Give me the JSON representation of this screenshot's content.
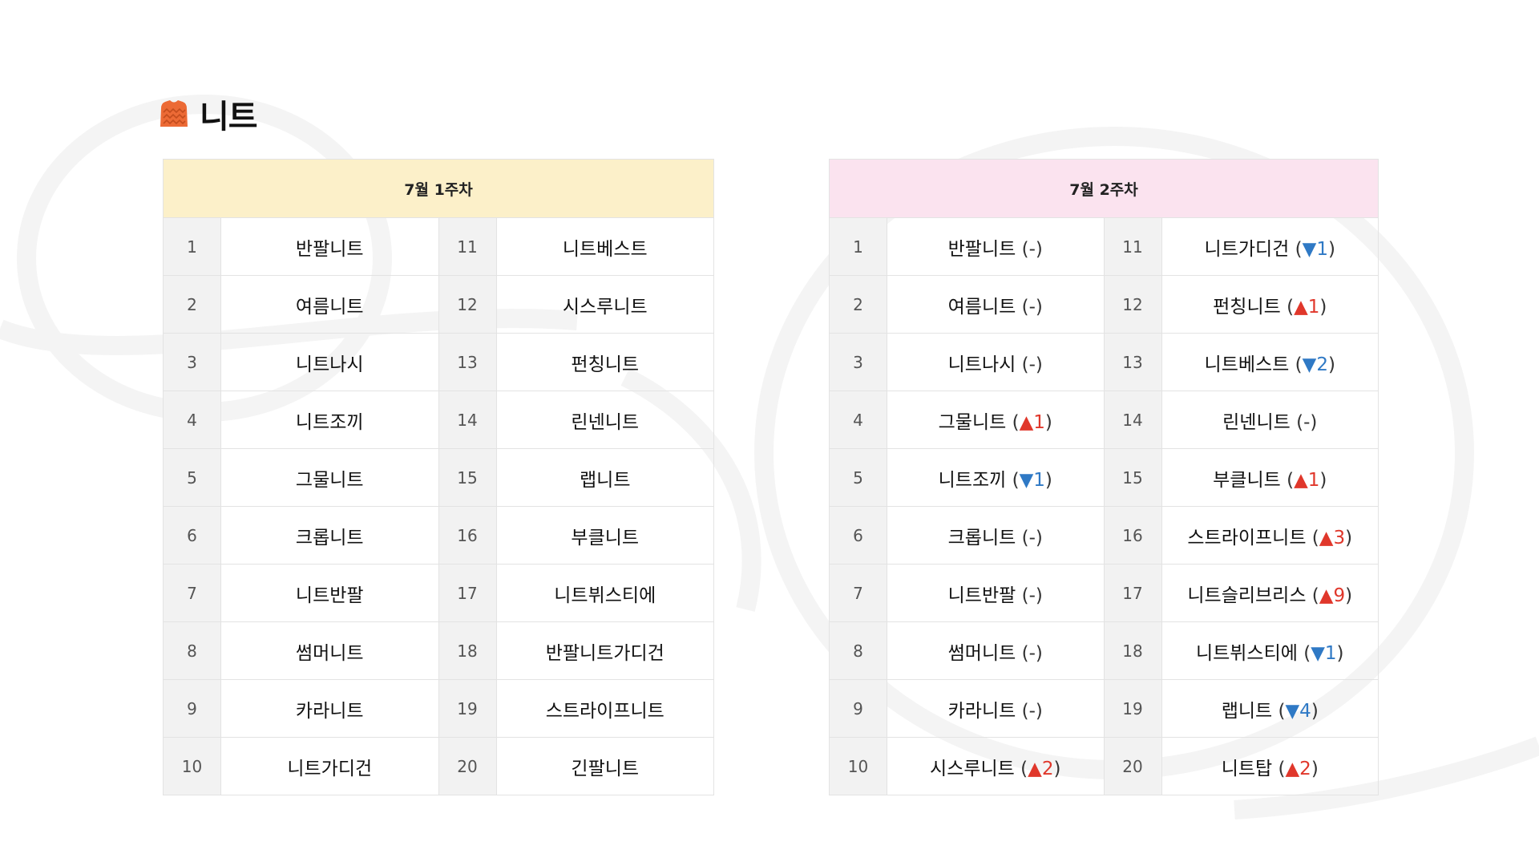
{
  "page": {
    "title": "니트",
    "icon": "knit-sweater-icon"
  },
  "colors": {
    "week1_header_bg": "#fcf0c9",
    "week2_header_bg": "#fbe3ef",
    "rank_up": "#e0372b",
    "rank_down": "#2f79c5",
    "rank_cell_bg": "#f2f2f2"
  },
  "week1": {
    "header": "7월 1주차",
    "rows": [
      {
        "rank_a": "1",
        "item_a": "반팔니트",
        "rank_b": "11",
        "item_b": "니트베스트"
      },
      {
        "rank_a": "2",
        "item_a": "여름니트",
        "rank_b": "12",
        "item_b": "시스루니트"
      },
      {
        "rank_a": "3",
        "item_a": "니트나시",
        "rank_b": "13",
        "item_b": "펀칭니트"
      },
      {
        "rank_a": "4",
        "item_a": "니트조끼",
        "rank_b": "14",
        "item_b": "린넨니트"
      },
      {
        "rank_a": "5",
        "item_a": "그물니트",
        "rank_b": "15",
        "item_b": "랩니트"
      },
      {
        "rank_a": "6",
        "item_a": "크롭니트",
        "rank_b": "16",
        "item_b": "부클니트"
      },
      {
        "rank_a": "7",
        "item_a": "니트반팔",
        "rank_b": "17",
        "item_b": "니트뷔스티에"
      },
      {
        "rank_a": "8",
        "item_a": "썸머니트",
        "rank_b": "18",
        "item_b": "반팔니트가디건"
      },
      {
        "rank_a": "9",
        "item_a": "카라니트",
        "rank_b": "19",
        "item_b": "스트라이프니트"
      },
      {
        "rank_a": "10",
        "item_a": "니트가디건",
        "rank_b": "20",
        "item_b": "긴팔니트"
      }
    ]
  },
  "week2": {
    "header": "7월 2주차",
    "rows": [
      {
        "rank_a": "1",
        "item_a": "반팔니트",
        "change_a": "-",
        "rank_b": "11",
        "item_b": "니트가디건",
        "change_b": "▼1"
      },
      {
        "rank_a": "2",
        "item_a": "여름니트",
        "change_a": "-",
        "rank_b": "12",
        "item_b": "펀칭니트",
        "change_b": "▲1"
      },
      {
        "rank_a": "3",
        "item_a": "니트나시",
        "change_a": "-",
        "rank_b": "13",
        "item_b": "니트베스트",
        "change_b": "▼2"
      },
      {
        "rank_a": "4",
        "item_a": "그물니트",
        "change_a": "▲1",
        "rank_b": "14",
        "item_b": "린넨니트",
        "change_b": "-"
      },
      {
        "rank_a": "5",
        "item_a": "니트조끼",
        "change_a": "▼1",
        "rank_b": "15",
        "item_b": "부클니트",
        "change_b": "▲1"
      },
      {
        "rank_a": "6",
        "item_a": "크롭니트",
        "change_a": "-",
        "rank_b": "16",
        "item_b": "스트라이프니트",
        "change_b": "▲3"
      },
      {
        "rank_a": "7",
        "item_a": "니트반팔",
        "change_a": "-",
        "rank_b": "17",
        "item_b": "니트슬리브리스",
        "change_b": "▲9"
      },
      {
        "rank_a": "8",
        "item_a": "썸머니트",
        "change_a": "-",
        "rank_b": "18",
        "item_b": "니트뷔스티에",
        "change_b": "▼1"
      },
      {
        "rank_a": "9",
        "item_a": "카라니트",
        "change_a": "-",
        "rank_b": "19",
        "item_b": "랩니트",
        "change_b": "▼4"
      },
      {
        "rank_a": "10",
        "item_a": "시스루니트",
        "change_a": "▲2",
        "rank_b": "20",
        "item_b": "니트탑",
        "change_b": "▲2"
      }
    ]
  }
}
